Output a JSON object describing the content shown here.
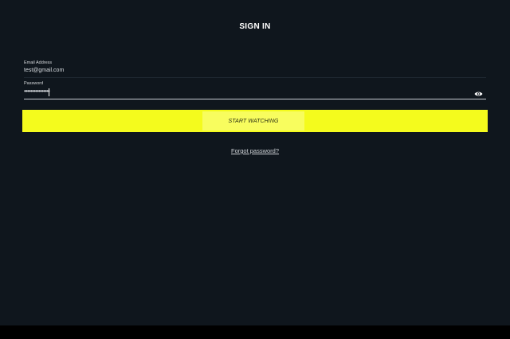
{
  "page": {
    "title": "SIGN IN"
  },
  "form": {
    "email": {
      "label": "Email Address",
      "value": "test@gmail.com"
    },
    "password": {
      "label": "Password",
      "value": "••••••••••••••••"
    },
    "submit_label": "START WATCHING",
    "forgot_label": "Forgot password?"
  },
  "icons": {
    "password_toggle": "eye-icon"
  },
  "colors": {
    "background": "#0f161d",
    "accent": "#f4fb1d"
  }
}
